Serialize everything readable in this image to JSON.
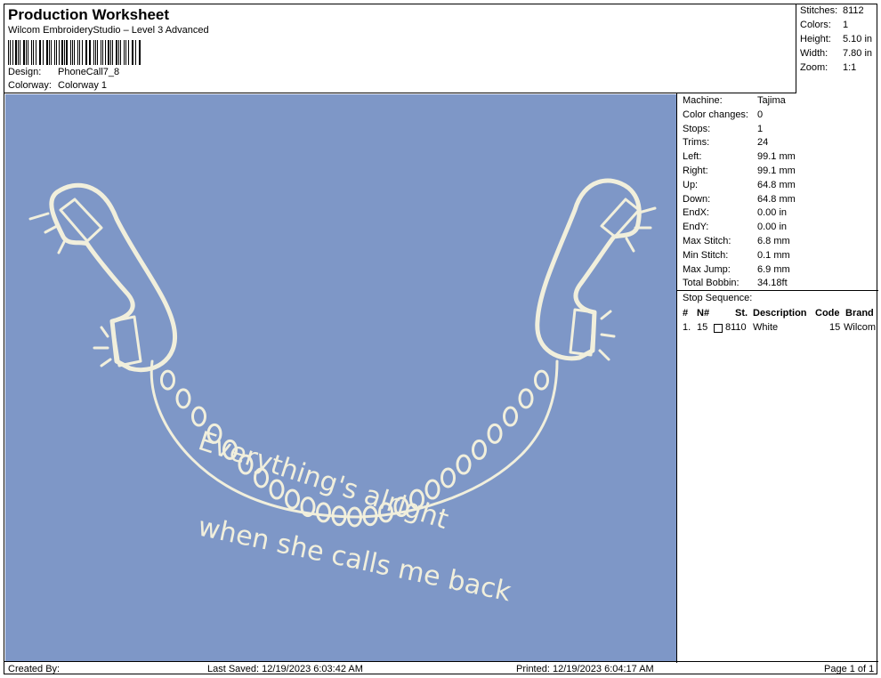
{
  "header": {
    "title": "Production Worksheet",
    "subtitle": "Wilcom EmbroideryStudio – Level 3 Advanced",
    "design_label": "Design:",
    "design_value": "PhoneCall7_8",
    "colorway_label": "Colorway:",
    "colorway_value": "Colorway 1"
  },
  "summary": {
    "stitches_label": "Stitches:",
    "stitches_value": "8112",
    "colors_label": "Colors:",
    "colors_value": "1",
    "height_label": "Height:",
    "height_value": "5.10 in",
    "width_label": "Width:",
    "width_value": "7.80 in",
    "zoom_label": "Zoom:",
    "zoom_value": "1:1"
  },
  "properties": [
    {
      "label": "Machine:",
      "value": "Tajima"
    },
    {
      "label": "Color changes:",
      "value": "0"
    },
    {
      "label": "Stops:",
      "value": "1"
    },
    {
      "label": "Trims:",
      "value": "24"
    },
    {
      "label": "Left:",
      "value": "99.1 mm"
    },
    {
      "label": "Right:",
      "value": "99.1 mm"
    },
    {
      "label": "Up:",
      "value": "64.8 mm"
    },
    {
      "label": "Down:",
      "value": "64.8 mm"
    },
    {
      "label": "EndX:",
      "value": "0.00 in"
    },
    {
      "label": "EndY:",
      "value": "0.00 in"
    },
    {
      "label": "Max Stitch:",
      "value": "6.8 mm"
    },
    {
      "label": "Min Stitch:",
      "value": "0.1 mm"
    },
    {
      "label": "Max Jump:",
      "value": "6.9 mm"
    },
    {
      "label": "Total Bobbin:",
      "value": "34.18ft"
    }
  ],
  "stop_sequence": {
    "title": "Stop Sequence:",
    "columns": {
      "num": "#",
      "n": "N#",
      "st": "St.",
      "description": "Description",
      "code": "Code",
      "brand": "Brand"
    },
    "rows": [
      {
        "num": "1.",
        "n": "15",
        "st": "8110",
        "description": "White",
        "code": "15",
        "brand": "Wilcom",
        "swatch_color": "#ffffff"
      }
    ]
  },
  "design": {
    "background_color": "#7e97c7",
    "thread_color": "#f1efdc",
    "line1": "Everything's alright",
    "line2": "when she calls me back"
  },
  "footer": {
    "created_by": "Created By:",
    "last_saved": "Last Saved: 12/19/2023 6:03:42 AM",
    "printed": "Printed: 12/19/2023 6:04:17 AM",
    "page": "Page 1 of 1"
  }
}
